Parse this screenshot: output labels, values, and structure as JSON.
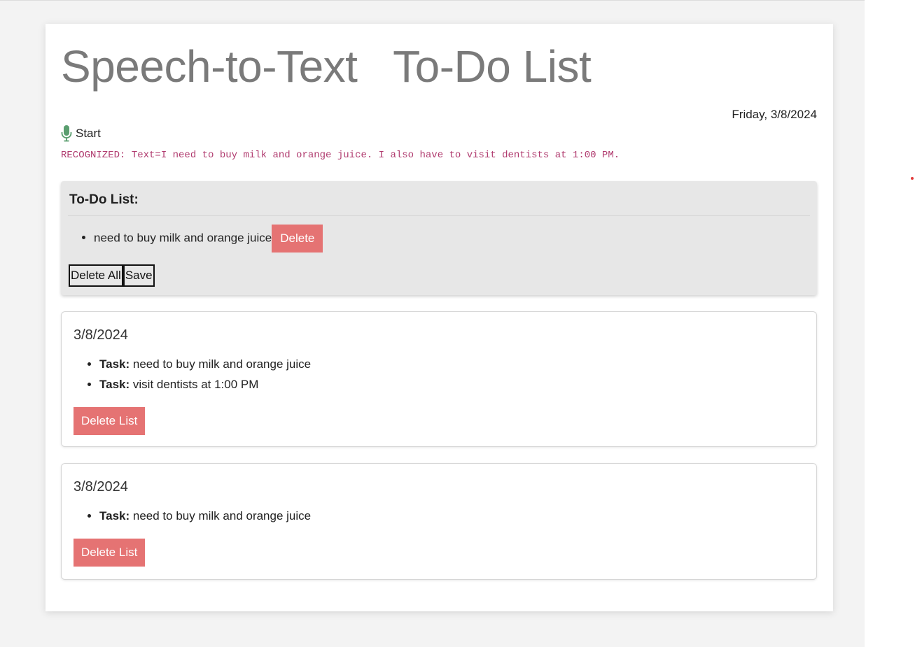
{
  "header": {
    "title": "Speech-to-Text   To-Do List",
    "date": "Friday, 3/8/2024"
  },
  "controls": {
    "mic_icon": "microphone-icon",
    "start_label": "Start"
  },
  "recognized_text": "RECOGNIZED: Text=I need to buy milk and orange juice. I also have to visit dentists at 1:00 PM.",
  "todo": {
    "heading": "To-Do List:",
    "items": [
      {
        "text": "need to buy milk and orange juice",
        "delete_label": "Delete"
      }
    ],
    "delete_all_label": "Delete All",
    "save_label": "Save"
  },
  "saved_lists": [
    {
      "date": "3/8/2024",
      "task_prefix": "Task:",
      "tasks": [
        "need to buy milk and orange juice",
        "visit dentists at 1:00 PM"
      ],
      "delete_label": "Delete List"
    },
    {
      "date": "3/8/2024",
      "task_prefix": "Task:",
      "tasks": [
        "need to buy milk and orange juice"
      ],
      "delete_label": "Delete List"
    }
  ],
  "colors": {
    "accent_red": "#e57373",
    "mic_green": "#5a9e6f",
    "recognized_text": "#b03a6e",
    "title_gray": "#7a7a7a"
  }
}
